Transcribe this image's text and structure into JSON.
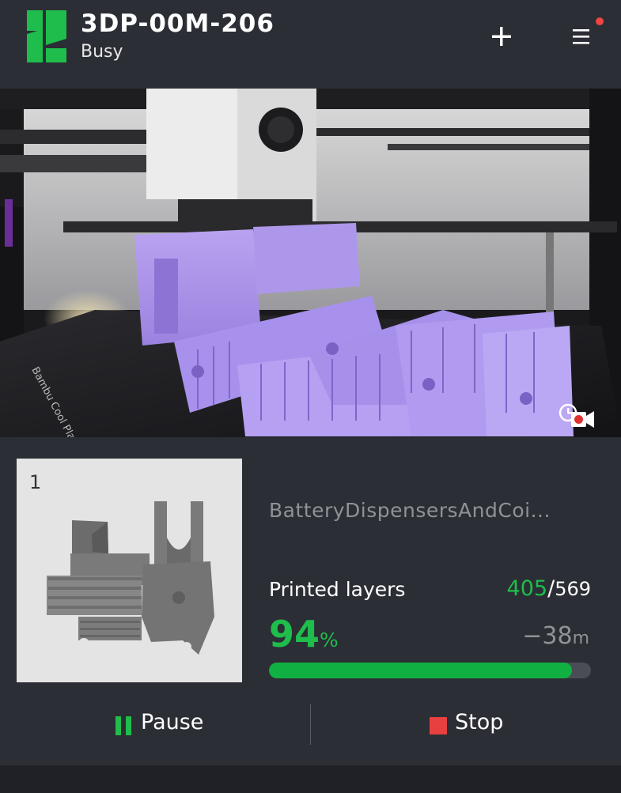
{
  "header": {
    "printer_name": "3DP-00M-206",
    "status": "Busy",
    "add_icon": "plus-icon",
    "menu_icon": "hamburger-menu-icon",
    "has_notification": true,
    "brand_color": "#1fbd4c",
    "notification_color": "#ee4444"
  },
  "camera": {
    "plate_label": "Bambu Cool Plate",
    "record_icon": "camera-record-icon"
  },
  "job": {
    "plate_number": "1",
    "file_name": "BatteryDispensersAndCoi...",
    "layers_label": "Printed layers",
    "layers_current": "405",
    "layers_separator": "/",
    "layers_total": "569",
    "percent_value": "94",
    "percent_sign": "%",
    "progress": 0.94,
    "remaining_value": "−38",
    "remaining_unit": "m",
    "progress_color": "#11b043"
  },
  "actions": {
    "pause_label": "Pause",
    "stop_label": "Stop",
    "pause_icon": "pause-icon",
    "stop_icon": "stop-icon",
    "stop_color": "#e84040"
  }
}
